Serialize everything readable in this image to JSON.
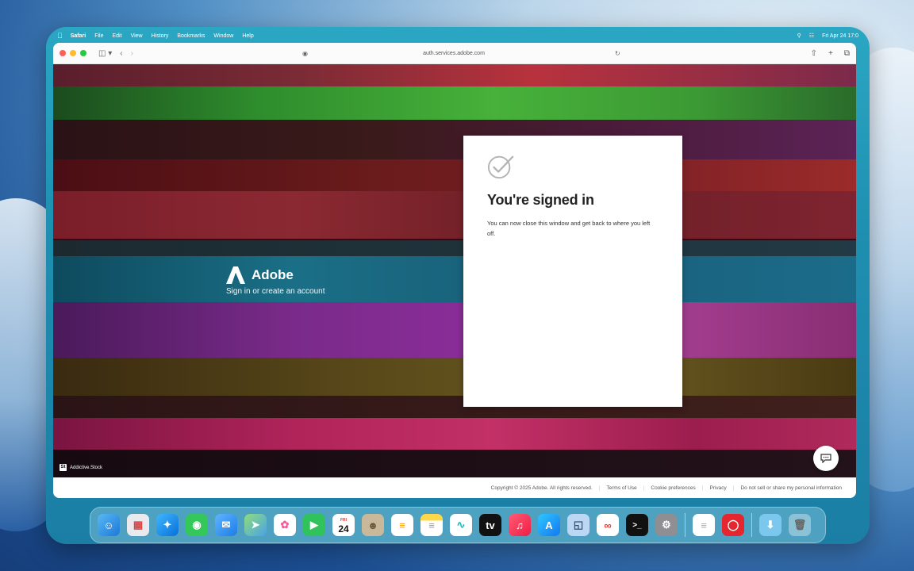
{
  "menubar": {
    "app": "Safari",
    "items": [
      "File",
      "Edit",
      "View",
      "History",
      "Bookmarks",
      "Window",
      "Help"
    ],
    "datetime": "Fri Apr 24  17:0"
  },
  "browser": {
    "url": "auth.services.adobe.com"
  },
  "page": {
    "brand_name": "Adobe",
    "brand_tagline": "Sign in or create an account",
    "card_title": "You're signed in",
    "card_message": "You can now close this window and get back to where you left off.",
    "image_credit": "Addictive.Stock"
  },
  "footer": {
    "copyright": "Copyright © 2025 Adobe. All rights reserved.",
    "links": [
      "Terms of Use",
      "Cookie preferences",
      "Privacy",
      "Do not sell or share my personal information"
    ]
  },
  "dock": {
    "calendar_day": "24",
    "calendar_month": "FRI",
    "apps": [
      "finder",
      "launchpad",
      "safari",
      "messages",
      "mail",
      "maps",
      "photos",
      "facetime",
      "calendar",
      "contacts",
      "reminders",
      "notes",
      "freeform",
      "tv",
      "music",
      "app-store",
      "preview",
      "creative-cloud",
      "terminal",
      "system-settings",
      "document",
      "acrobat",
      "downloads-folder",
      "trash"
    ]
  },
  "colors": {
    "card_bg": "#ffffff",
    "accent_frame": "#1e8fb0"
  }
}
